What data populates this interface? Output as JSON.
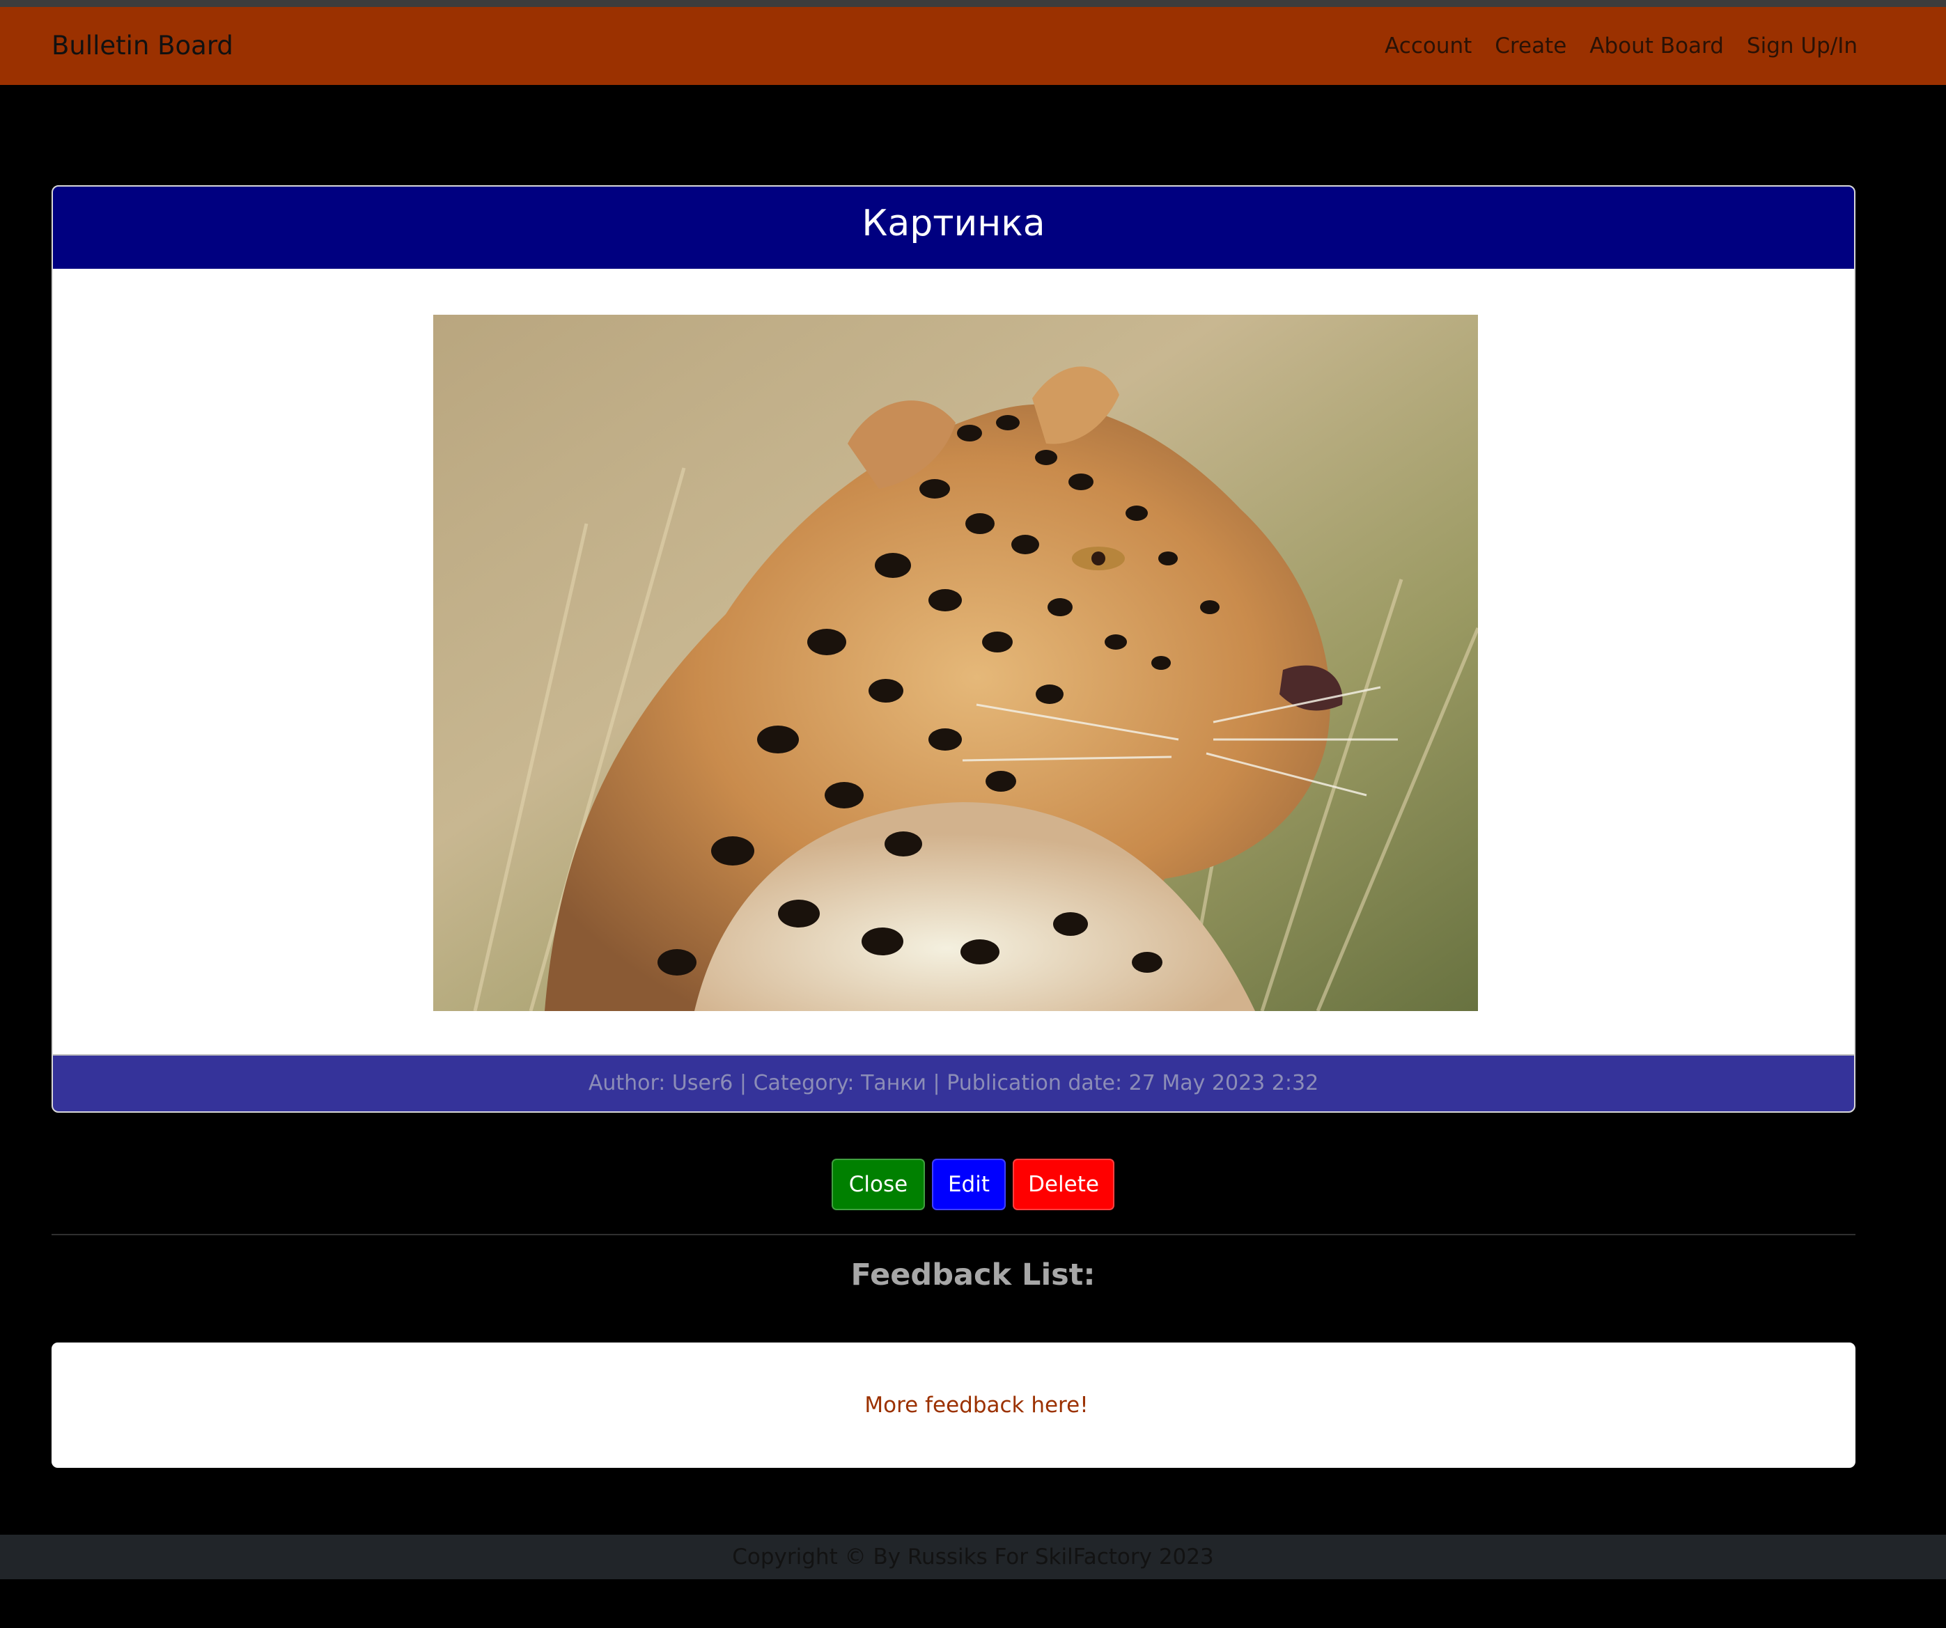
{
  "navbar": {
    "brand": "Bulletin Board",
    "links": [
      "Account",
      "Create",
      "About Board",
      "Sign Up/In"
    ]
  },
  "post": {
    "title": "Картинка",
    "image_description": "",
    "meta": "Author: User6 | Category: Танки | Publication date: 27 May 2023 2:32"
  },
  "actions": {
    "close": "Close",
    "edit": "Edit",
    "delete": "Delete"
  },
  "feedback": {
    "title": "Feedback List:",
    "more_link": "More feedback here!"
  },
  "footer": {
    "copyright": "Copyright © By Russiks For SkilFactory 2023"
  },
  "colors": {
    "navbar": "#9b3100",
    "post_header": "#000080",
    "post_footer": "#35339a",
    "close_button": "#008000",
    "edit_button": "#0000ff",
    "delete_button": "#ff0000",
    "link": "#9b3100",
    "page_footer": "#212529"
  }
}
